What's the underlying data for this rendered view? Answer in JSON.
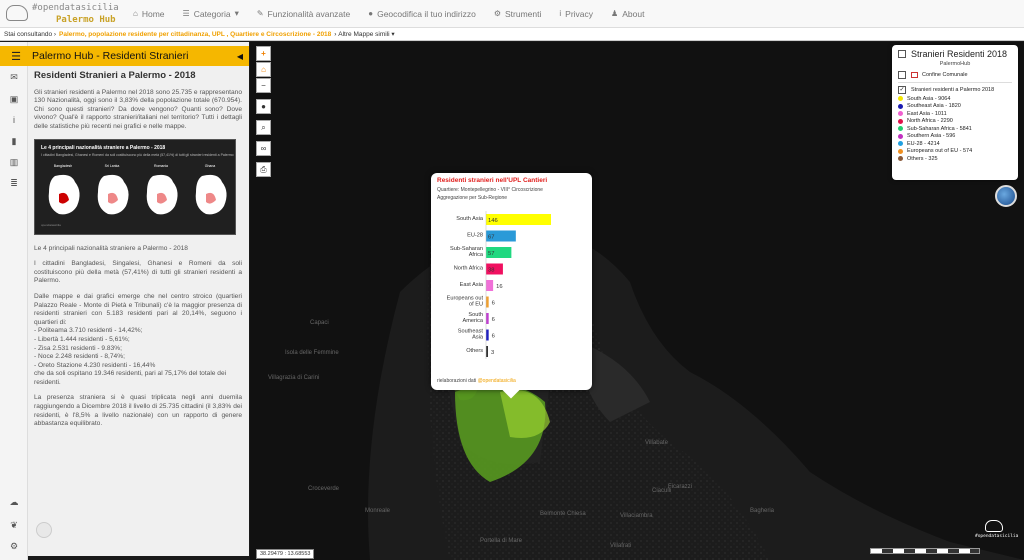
{
  "header": {
    "logo_top": "#opendatasicilia",
    "logo_bottom": "Palermo Hub",
    "nav": [
      {
        "label": "Home",
        "icon": "home-icon"
      },
      {
        "label": "Categoria",
        "icon": "list-icon"
      },
      {
        "label": "Funzionalità avanzate",
        "icon": "chat-icon"
      },
      {
        "label": "Geocodifica il tuo indirizzo",
        "icon": "pin-icon"
      },
      {
        "label": "Strumenti",
        "icon": "gear-icon"
      },
      {
        "label": "Privacy",
        "icon": "info-icon"
      },
      {
        "label": "About",
        "icon": "people-icon"
      }
    ]
  },
  "breadcrumb": {
    "prefix": "Stai consultando",
    "current": "Palermo, popolazione residente per cittadinanza, UPL , Quartiere e Circoscrizione - 2018",
    "more": "Altre Mappe simili"
  },
  "sidebar": {
    "title": "Palermo Hub - Residenti Stranieri",
    "heading": "Residenti Stranieri a Palermo - 2018",
    "intro": "Gli stranieri residenti a Palermo nel 2018 sono 25.735 e rappresentano 130 Nazionalità, oggi sono il 3,83% della popolazione totale (670.954). Chi sono questi stranieri? Da dove vengono? Quanti sono? Dove vivono? Qual'è il rapporto stranieri/italiani nel territorio? Tutti i dettagli delle statistiche più recenti nei grafici e nelle mappe.",
    "infographic_title": "Le 4 principali nazionalità straniere a Palermo - 2018",
    "infographic_sub": "I cittadini Bangladesi, Ghanesi e Romeni da soli costituiscono più della metà (57,41%) di tutti gli stranieri residenti a Palermo",
    "infographic_maps": [
      "Bangladesh",
      "Sri Lanka",
      "Romania",
      "Ghana"
    ],
    "caption": "Le 4 principali nazionalità straniere a Palermo - 2018",
    "p2": "I cittadini Bangladesi, Singalesi, Ghanesi e Romeni da soli costituiscono più della metà (57,41%) di tutti gli stranieri residenti a Palermo.",
    "p3_lines": [
      "Dalle mappe e dai grafici emerge che nel centro stroico (quartieri Palazzo Reale - Monte di Pietà e Tribunali) c'è la maggior presenza di residenti stranieri con 5.183 residenti pari al 20,14%, seguono i quartieri di:",
      "- Politeama 3.710 residenti - 14,42%;",
      "- Libertà 1.444 residenti - 5,61%;",
      "- Zisa 2.531 residenti - 9.83%;",
      "- Noce 2.248 residenti - 8,74%;",
      "- Oreto Stazione 4.230 residenti - 16,44%",
      "che da soli ospitano 19.346 residenti, pari al 75,17% del totale dei residenti."
    ],
    "p4": "La presenza straniera si è quasi triplicata negli anni duemila raggiungendo a Dicembre 2018 il livello di 25.735 cittadini (il 3,83% dei residenti, è l'8,5% a livello nazionale) con un rapporto di genere abbastanza equilibrato."
  },
  "legend": {
    "title": "Stranieri Residenti 2018",
    "subtitle": "PalermoHub",
    "boundary": "Confine Comunale",
    "layer": "Stranieri residenti a Palermo 2018",
    "items": [
      {
        "label": "South Asia - 9064",
        "color": "#f2e600"
      },
      {
        "label": "Southeast Asia - 1820",
        "color": "#1a1ab0"
      },
      {
        "label": "East Asia - 1011",
        "color": "#f060d0"
      },
      {
        "label": "North Africa - 2290",
        "color": "#e0104a"
      },
      {
        "label": "Sub-Saharan Africa - 5841",
        "color": "#20d070"
      },
      {
        "label": "Southern Asia - 596",
        "color": "#c030c0"
      },
      {
        "label": "EU-28 - 4214",
        "color": "#20a0e0"
      },
      {
        "label": "Europeans out of EU - 574",
        "color": "#f09020"
      },
      {
        "label": "Others - 325",
        "color": "#8a5a3a"
      }
    ]
  },
  "popup": {
    "title": "Residenti stranieri nell'UPL Cantieri",
    "line1": "Quartiere: Montepellegrino - VIII° Circoscrizione",
    "line2": "Aggregazione per Sub-Regione",
    "footer_prefix": "rielaborazioni dati",
    "footer_link": "@opendatasicilia"
  },
  "chart_data": {
    "type": "bar",
    "orientation": "horizontal",
    "categories": [
      "South Asia",
      "EU-28",
      "Sub-Saharan Africa",
      "North Africa",
      "East Asia",
      "Europeans out of EU",
      "South America",
      "Southeast Asia",
      "Others"
    ],
    "values": [
      146,
      67,
      57,
      38,
      16,
      6,
      6,
      6,
      3
    ],
    "colors": [
      "#ffff00",
      "#2a9ad8",
      "#20d880",
      "#f01060",
      "#f070d8",
      "#f0a030",
      "#c040d0",
      "#2020c0",
      "#333333"
    ]
  },
  "map": {
    "coords": "38.29479 : 13.68553",
    "places": [
      "Capaci",
      "Isola delle Femmine",
      "Villagrazia di Carini",
      "Villabate",
      "Ficarazzi",
      "Bagheria",
      "Monreale",
      "Belmonte Chiesa",
      "Villaciambra",
      "Portella di Mare",
      "Villafrati",
      "Ciaculli",
      "Croceverde"
    ],
    "brand": "#opendatasicilia"
  }
}
